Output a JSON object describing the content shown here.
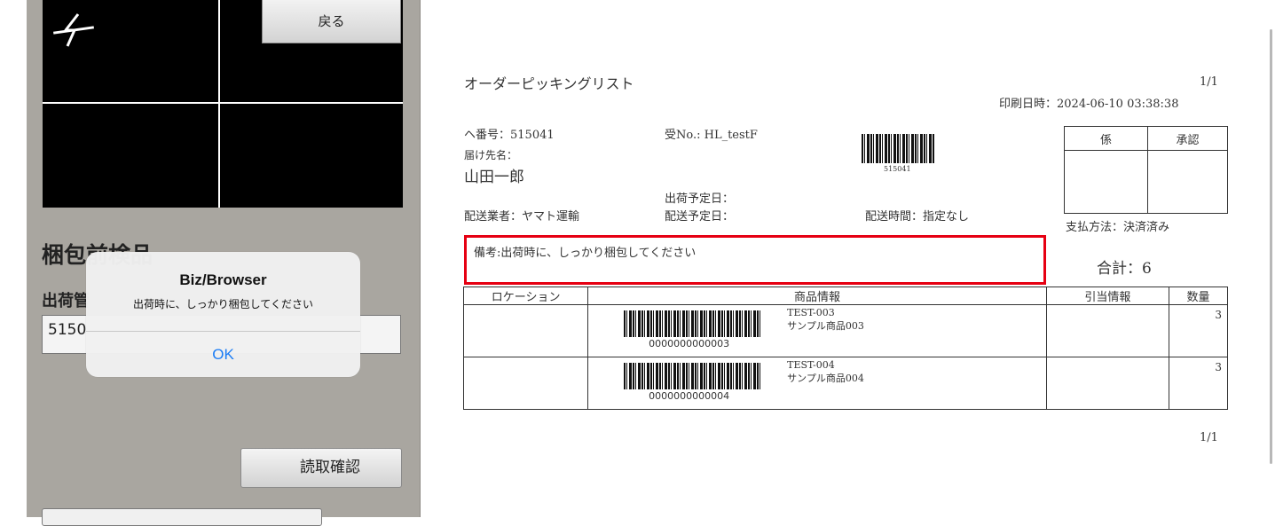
{
  "scanner": {
    "back_label": "戻る",
    "section_title": "梱包前検品",
    "field_label": "出荷管",
    "input_value": "5150",
    "confirm_label": "読取確認"
  },
  "alert": {
    "title": "Biz/Browser",
    "message": "出荷時に、しっかり梱包してください",
    "ok_label": "OK"
  },
  "document": {
    "title": "オーダーピッキングリスト",
    "page_top": "1/1",
    "print_datetime": "印刷日時：2024-06-10 03:38:38",
    "order_no": "ヘ番号：515041",
    "receipt_no": "受No.: HL_testF",
    "barcode_number": "515041",
    "dest_label": "届け先名：",
    "dest_name": "山田一郎",
    "ship_date": "出荷予定日：",
    "carrier": "配送業者：ヤマト運輸",
    "delivery_date": "配送予定日：",
    "delivery_time": "配送時間：指定なし",
    "approval_headers": [
      "係",
      "承認"
    ],
    "payment": "支払方法：決済済み",
    "remark": "備考:出荷時に、しっかり梱包してください",
    "total": "合計：6",
    "table_headers": [
      "ロケーション",
      "商品情報",
      "引当情報",
      "数量"
    ],
    "items": [
      {
        "barcode_text": "0000000000003",
        "code": "TEST-003",
        "name": "サンプル商品003",
        "qty": "3"
      },
      {
        "barcode_text": "0000000000004",
        "code": "TEST-004",
        "name": "サンプル商品004",
        "qty": "3"
      }
    ],
    "page_bottom": "1/1"
  }
}
